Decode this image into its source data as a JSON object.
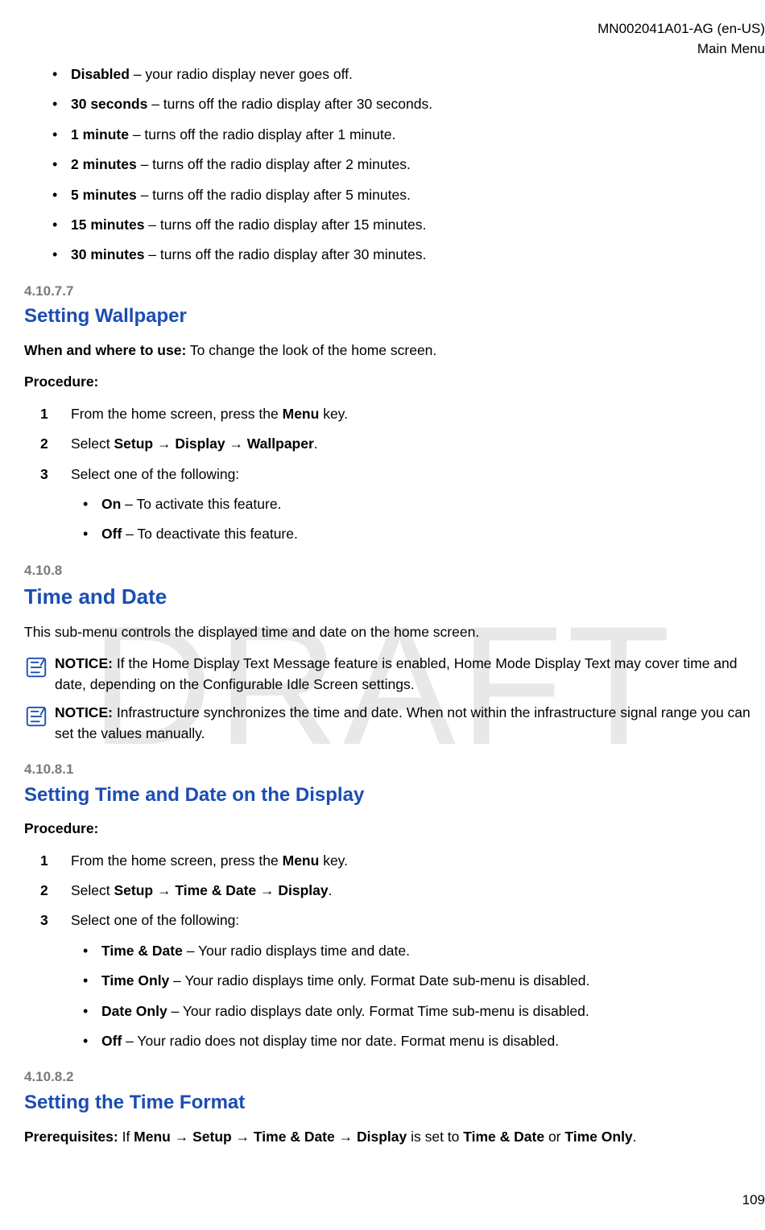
{
  "header": {
    "doc_id": "MN002041A01-AG (en-US)",
    "section_name": "Main Menu"
  },
  "footer": {
    "page_number": "109"
  },
  "watermark": "DRAFT",
  "bullets_top": [
    {
      "term": "Disabled",
      "desc": " – your radio display never goes off."
    },
    {
      "term": "30 seconds",
      "desc": " – turns off the radio display after 30 seconds."
    },
    {
      "term": "1 minute",
      "desc": " – turns off the radio display after 1 minute."
    },
    {
      "term": "2 minutes",
      "desc": " – turns off the radio display after 2 minutes."
    },
    {
      "term": "5 minutes",
      "desc": " – turns off the radio display after 5 minutes."
    },
    {
      "term": "15 minutes",
      "desc": " – turns off the radio display after 15 minutes."
    },
    {
      "term": "30 minutes",
      "desc": " – turns off the radio display after 30 minutes."
    }
  ],
  "sec_41077": {
    "num": "4.10.7.7",
    "title": "Setting Wallpaper",
    "when_label": "When and where to use:",
    "when_text": " To change the look of the home screen.",
    "proc_label": "Procedure:",
    "steps": [
      {
        "pre": "From the home screen, press the ",
        "bold": "Menu",
        "post": " key."
      },
      {
        "pre": "Select ",
        "bold": "Setup → Display → Wallpaper",
        "post": "."
      },
      {
        "pre": "Select one of the following:",
        "bold": "",
        "post": ""
      }
    ],
    "subbullets": [
      {
        "term": "On",
        "desc": " – To activate this feature."
      },
      {
        "term": "Off",
        "desc": " – To deactivate this feature."
      }
    ]
  },
  "sec_4108": {
    "num": "4.10.8",
    "title": "Time and Date",
    "intro": "This sub-menu controls the displayed time and date on the home screen.",
    "notice1_label": "NOTICE:",
    "notice1_text": " If the Home Display Text Message feature is enabled, Home Mode Display Text may cover time and date, depending on the Configurable Idle Screen settings.",
    "notice2_label": "NOTICE:",
    "notice2_text": " Infrastructure synchronizes the time and date. When not within the infrastructure signal range you can set the values manually."
  },
  "sec_41081": {
    "num": "4.10.8.1",
    "title": "Setting Time and Date on the Display",
    "proc_label": "Procedure:",
    "steps": [
      {
        "pre": "From the home screen, press the ",
        "bold": "Menu",
        "post": " key."
      },
      {
        "pre": "Select ",
        "bold": "Setup → Time & Date → Display",
        "post": "."
      },
      {
        "pre": "Select one of the following:",
        "bold": "",
        "post": ""
      }
    ],
    "subbullets": [
      {
        "term": "Time & Date",
        "desc": " – Your radio displays time and date."
      },
      {
        "term": "Time Only",
        "desc": " – Your radio displays time only. Format Date sub-menu is disabled."
      },
      {
        "term": "Date Only",
        "desc": " – Your radio displays date only. Format Time sub-menu is disabled."
      },
      {
        "term": "Off",
        "desc": " – Your radio does not display time nor date. Format menu is disabled."
      }
    ]
  },
  "sec_41082": {
    "num": "4.10.8.2",
    "title": "Setting the Time Format",
    "prereq_label": "Prerequisites:",
    "prereq_pre": " If ",
    "prereq_bold1": "Menu → Setup → Time & Date → Display",
    "prereq_mid": " is set to ",
    "prereq_bold2": "Time & Date",
    "prereq_or": " or ",
    "prereq_bold3": "Time Only",
    "prereq_end": "."
  }
}
